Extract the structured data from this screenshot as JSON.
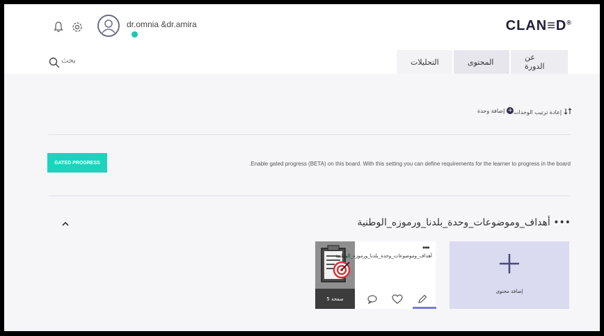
{
  "header": {
    "username": "dr.omnia &dr.amira",
    "logo": "CLAN≡D",
    "logo_mark": "®",
    "search_placeholder": "بحث"
  },
  "tabs": [
    {
      "label": "عن الدورة",
      "active": false
    },
    {
      "label": "المحتوى",
      "active": true
    },
    {
      "label": "التحليلات",
      "active": false
    }
  ],
  "toolbar": {
    "reorder_label": "إعادة ترتيب الوحدات",
    "add_unit_label": "إضافة وحدة"
  },
  "gated": {
    "button_label": "GATED PROGRESS",
    "description": ".Enable gated progress (BETA) on this board. With this setting you can define requirements for the learner to progress in the board"
  },
  "section": {
    "title": "أهداف_وموضوعات_وحدة_بلدنا_ورموزه_الوطنية •••"
  },
  "content_card": {
    "title": "أهداف_وموضوعات_وحدة_بلدنا_ورموزه_الوطنية",
    "pages": "5 صفحة"
  },
  "add_card": {
    "label": "إضافة محتوى"
  },
  "colors": {
    "accent": "#1dd3bd",
    "online": "#1cc7b0",
    "add_card_bg": "#dadaf0",
    "tab_underline": "#7a7ad6"
  }
}
